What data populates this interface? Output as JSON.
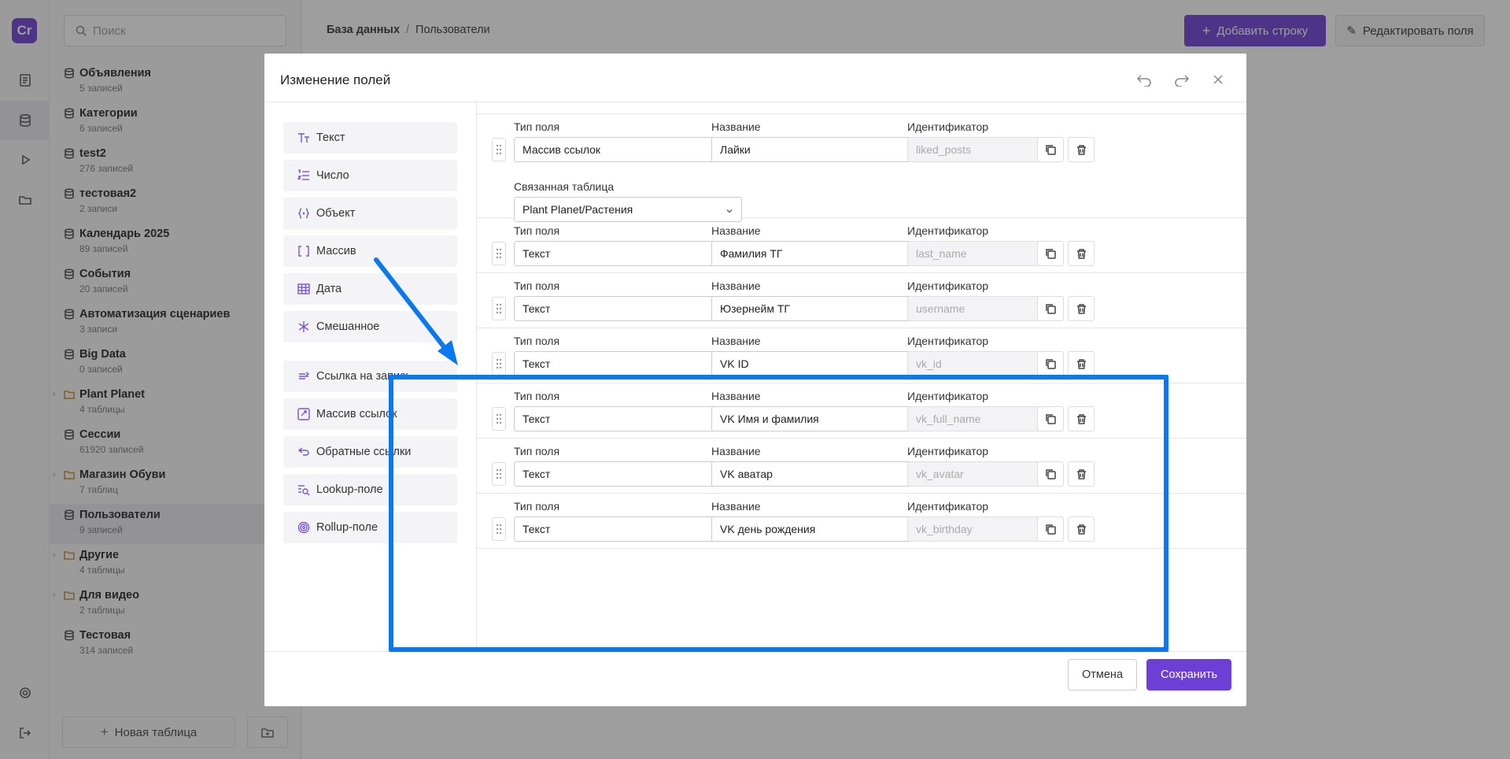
{
  "app": {
    "logo_text": "Cr"
  },
  "rail": {
    "items": [
      "document-icon",
      "database-icon",
      "play-icon",
      "folder-icon"
    ],
    "bottom": [
      "gear-icon",
      "logout-icon"
    ]
  },
  "panel": {
    "search_placeholder": "Поиск",
    "tables": [
      {
        "name": "Объявления",
        "sub": "5 записей",
        "kind": "table"
      },
      {
        "name": "Категории",
        "sub": "6 записей",
        "kind": "table"
      },
      {
        "name": "test2",
        "sub": "276 записей",
        "kind": "table"
      },
      {
        "name": "тестовая2",
        "sub": "2 записи",
        "kind": "table"
      },
      {
        "name": "Календарь 2025",
        "sub": "89 записей",
        "kind": "table"
      },
      {
        "name": "События",
        "sub": "20 записей",
        "kind": "table"
      },
      {
        "name": "Автоматизация сценариев",
        "sub": "3 записи",
        "kind": "table"
      },
      {
        "name": "Big Data",
        "sub": "0 записей",
        "kind": "table"
      },
      {
        "name": "Plant Planet",
        "sub": "4 таблицы",
        "kind": "folder"
      },
      {
        "name": "Сессии",
        "sub": "61920 записей",
        "kind": "table"
      },
      {
        "name": "Магазин Обуви",
        "sub": "7 таблиц",
        "kind": "folder"
      },
      {
        "name": "Пользователи",
        "sub": "9 записей",
        "kind": "table",
        "active": true
      },
      {
        "name": "Другие",
        "sub": "4 таблицы",
        "kind": "folder"
      },
      {
        "name": "Для видео",
        "sub": "2 таблицы",
        "kind": "folder"
      },
      {
        "name": "Тестовая",
        "sub": "314 записей",
        "kind": "table"
      }
    ],
    "new_table": "Новая таблица"
  },
  "header": {
    "crumb_root": "База данных",
    "crumb_sep": "/",
    "crumb_current": "Пользователи",
    "add_row": "Добавить строку",
    "edit_fields": "Редактировать поля"
  },
  "modal": {
    "title": "Изменение полей",
    "types": [
      {
        "label": "Текст",
        "icon": "text-type-icon"
      },
      {
        "label": "Число",
        "icon": "number-list-icon"
      },
      {
        "label": "Объект",
        "icon": "object-braces-icon"
      },
      {
        "label": "Массив",
        "icon": "array-brackets-icon"
      },
      {
        "label": "Дата",
        "icon": "calendar-grid-icon"
      },
      {
        "label": "Смешанное",
        "icon": "asterisk-icon"
      }
    ],
    "link_types": [
      {
        "label": "Ссылка на запись",
        "icon": "record-link-icon"
      },
      {
        "label": "Массив ссылок",
        "icon": "link-array-icon"
      },
      {
        "label": "Обратные ссылки",
        "icon": "backlink-icon"
      },
      {
        "label": "Lookup-поле",
        "icon": "lookup-icon"
      },
      {
        "label": "Rollup-поле",
        "icon": "rollup-icon"
      }
    ],
    "label_type": "Тип поля",
    "label_name": "Название",
    "label_id": "Идентификатор",
    "label_linked": "Связанная таблица",
    "fields": [
      {
        "type": "Массив ссылок",
        "name": "Лайки",
        "id": "liked_posts",
        "linked": "Plant Planet/Растения"
      },
      {
        "type": "Текст",
        "name": "Фамилия ТГ",
        "id": "last_name"
      },
      {
        "type": "Текст",
        "name": "Юзернейм ТГ",
        "id": "username"
      },
      {
        "type": "Текст",
        "name": "VK ID",
        "id": "vk_id"
      },
      {
        "type": "Текст",
        "name": "VK Имя и фамилия",
        "id": "vk_full_name"
      },
      {
        "type": "Текст",
        "name": "VK аватар",
        "id": "vk_avatar"
      },
      {
        "type": "Текст",
        "name": "VK день рождения",
        "id": "vk_birthday"
      }
    ],
    "cancel": "Отмена",
    "save": "Сохранить"
  },
  "colors": {
    "accent": "#6d3fd6",
    "highlight": "#0a78f0"
  }
}
